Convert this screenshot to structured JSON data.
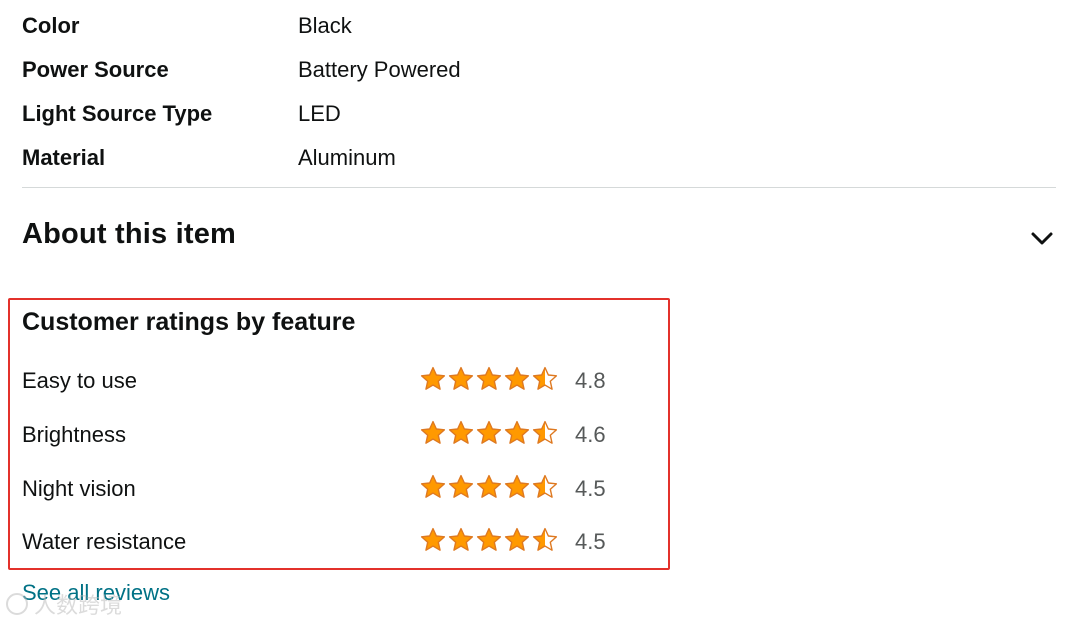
{
  "specs": [
    {
      "key": "Color",
      "value": "Black"
    },
    {
      "key": "Power Source",
      "value": "Battery Powered"
    },
    {
      "key": "Light Source Type",
      "value": "LED"
    },
    {
      "key": "Material",
      "value": "Aluminum"
    }
  ],
  "about": {
    "title": "About this item",
    "icon": "chevron-down-icon"
  },
  "ratings": {
    "title": "Customer ratings by feature",
    "star_color": "#ff9900",
    "star_border": "#de7921",
    "features": [
      {
        "label": "Easy to use",
        "value": "4.8"
      },
      {
        "label": "Brightness",
        "value": "4.6"
      },
      {
        "label": "Night vision",
        "value": "4.5"
      },
      {
        "label": "Water resistance",
        "value": "4.5"
      }
    ],
    "stars_shown": 4.5
  },
  "links": {
    "see_all_reviews": "See all reviews"
  },
  "watermark": {
    "text": "人数跨境"
  }
}
